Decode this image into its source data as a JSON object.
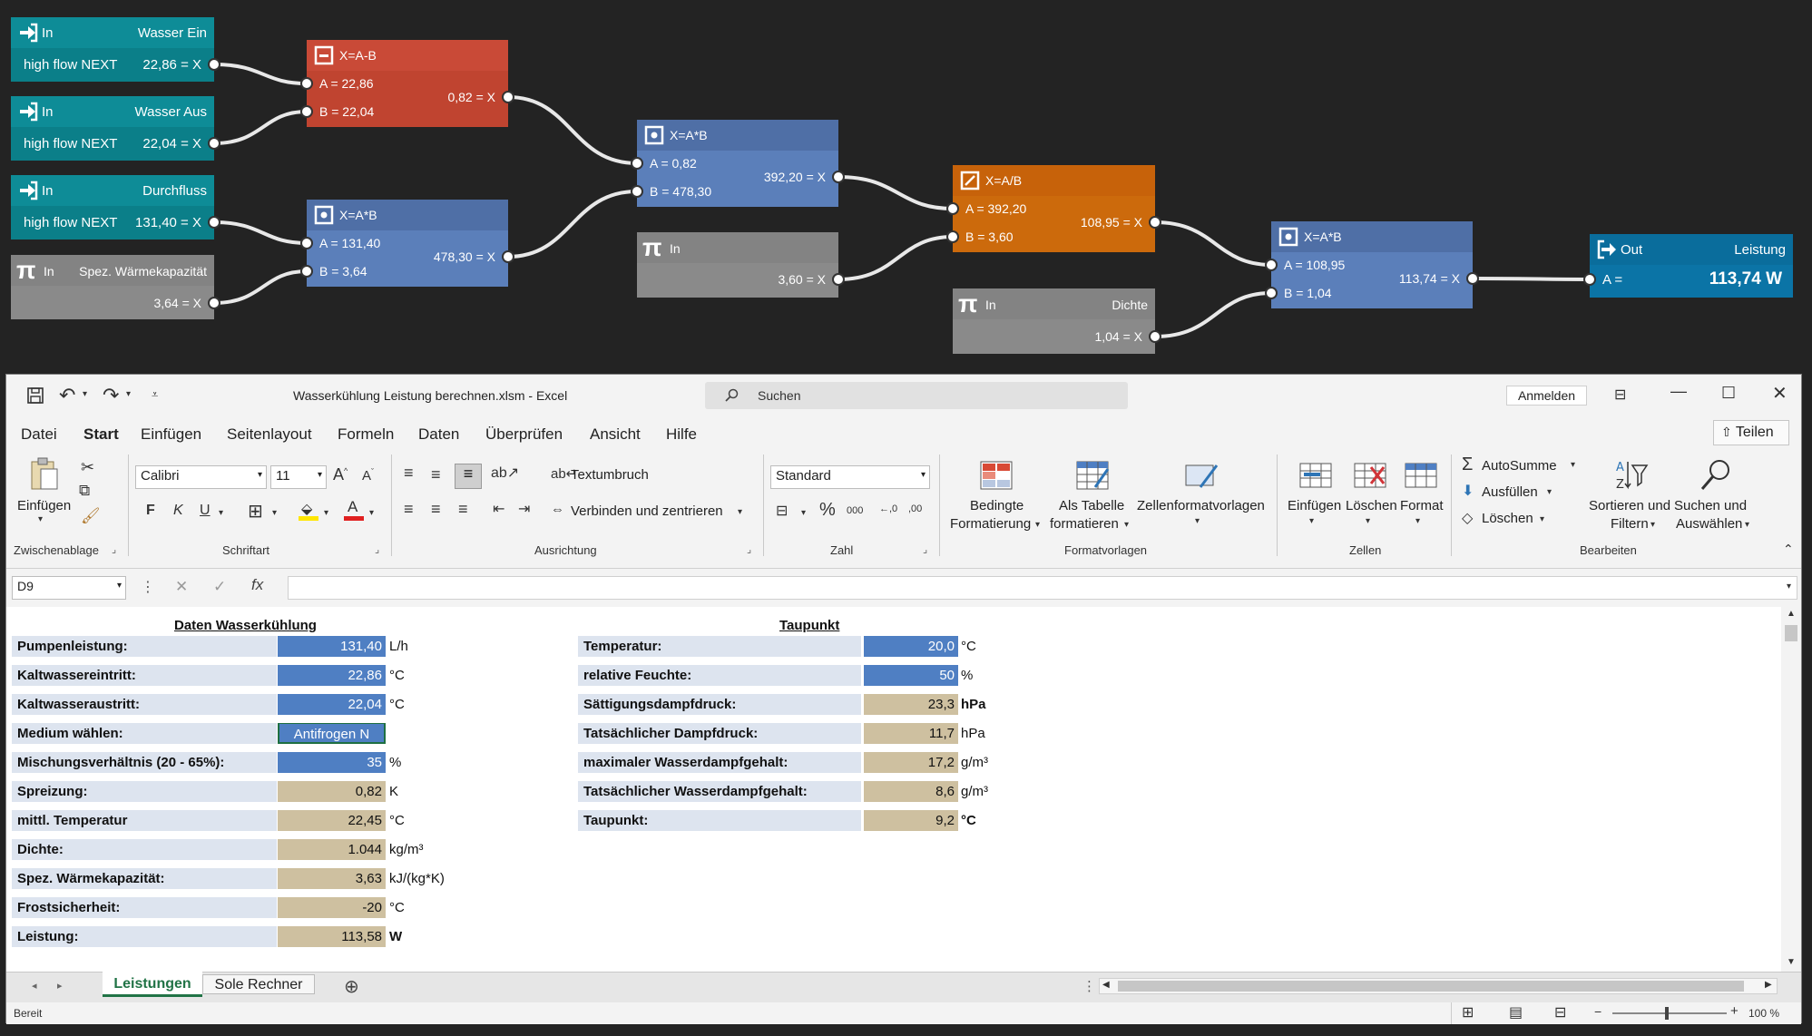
{
  "nodes": {
    "in1": {
      "kind": "In",
      "name": "Wasser Ein",
      "device": "high flow NEXT",
      "value": "22,86 = X"
    },
    "in2": {
      "kind": "In",
      "name": "Wasser Aus",
      "device": "high flow NEXT",
      "value": "22,04 = X"
    },
    "in3": {
      "kind": "In",
      "name": "Durchfluss",
      "device": "high flow NEXT",
      "value": "131,40 = X"
    },
    "const1": {
      "kind": "In",
      "name": "Spez. Wärmekapazität",
      "value": "3,64 = X"
    },
    "sub": {
      "op": "X=A-B",
      "a": "A = 22,86",
      "b": "B = 22,04",
      "out": "0,82 = X"
    },
    "mul1": {
      "op": "X=A*B",
      "a": "A = 131,40",
      "b": "B = 3,64",
      "out": "478,30 = X"
    },
    "mul2": {
      "op": "X=A*B",
      "a": "A = 0,82",
      "b": "B = 478,30",
      "out": "392,20 = X"
    },
    "const2": {
      "kind": "In",
      "value": "3,60 = X"
    },
    "div": {
      "op": "X=A/B",
      "a": "A = 392,20",
      "b": "B = 3,60",
      "out": "108,95 = X"
    },
    "const3": {
      "kind": "In",
      "name": "Dichte",
      "value": "1,04 = X"
    },
    "mul3": {
      "op": "X=A*B",
      "a": "A = 108,95",
      "b": "B = 1,04",
      "out": "113,74 = X"
    },
    "out": {
      "kind": "Out",
      "name": "Leistung",
      "a": "A =",
      "value": "113,74 W"
    }
  },
  "excel": {
    "title": "Wasserkühlung Leistung berechnen.xlsm  -  Excel",
    "search": "Suchen",
    "signin": "Anmelden",
    "share": "Teilen",
    "tabs": [
      "Datei",
      "Start",
      "Einfügen",
      "Seitenlayout",
      "Formeln",
      "Daten",
      "Überprüfen",
      "Ansicht",
      "Hilfe"
    ],
    "ribbon": {
      "paste": "Einfügen",
      "font": "Calibri",
      "size": "11",
      "wrap": "Textumbruch",
      "merge": "Verbinden und zentrieren",
      "numfmt": "Standard",
      "cond1": "Bedingte",
      "cond2": "Formatierung",
      "table1": "Als Tabelle",
      "table2": "formatieren",
      "cellstyles": "Zellenformatvorlagen",
      "ins": "Einfügen",
      "del": "Löschen",
      "fmt": "Format",
      "autosum": "AutoSumme",
      "fill": "Ausfüllen",
      "clear": "Löschen",
      "sort1": "Sortieren und",
      "sort2": "Filtern",
      "find1": "Suchen und",
      "find2": "Auswählen",
      "groups": {
        "clipboard": "Zwischenablage",
        "font": "Schriftart",
        "align": "Ausrichtung",
        "number": "Zahl",
        "styles": "Formatvorlagen",
        "cells": "Zellen",
        "edit": "Bearbeiten"
      }
    },
    "namebox": "D9",
    "sheet_tabs": [
      "Leistungen",
      "Sole Rechner"
    ],
    "status": "Bereit",
    "zoom": "100 %"
  },
  "left_table": {
    "header": "Daten Wasserkühlung",
    "rows": [
      {
        "label": "Pumpenleistung:",
        "value": "131,40",
        "unit": "L/h",
        "kind": "in"
      },
      {
        "label": "Kaltwassereintritt:",
        "value": "22,86",
        "unit": "°C",
        "kind": "in"
      },
      {
        "label": "Kaltwasseraustritt:",
        "value": "22,04",
        "unit": "°C",
        "kind": "in"
      },
      {
        "label": "Medium wählen:",
        "value": "Antifrogen N",
        "unit": "",
        "kind": "sel"
      },
      {
        "label": "Mischungsverhältnis (20 - 65%):",
        "value": "35",
        "unit": "%",
        "kind": "in"
      },
      {
        "label": "Spreizung:",
        "value": "0,82",
        "unit": "K",
        "kind": "out"
      },
      {
        "label": "mittl. Temperatur",
        "value": "22,45",
        "unit": "°C",
        "kind": "out"
      },
      {
        "label": "Dichte:",
        "value": "1.044",
        "unit": "kg/m³",
        "kind": "out"
      },
      {
        "label": "Spez. Wärmekapazität:",
        "value": "3,63",
        "unit": "kJ/(kg*K)",
        "kind": "out"
      },
      {
        "label": "Frostsicherheit:",
        "value": "-20",
        "unit": "°C",
        "kind": "out"
      },
      {
        "label": "Leistung:",
        "value": "113,58",
        "unit": "W",
        "kind": "outb"
      }
    ]
  },
  "right_table": {
    "header": "Taupunkt",
    "rows": [
      {
        "label": "Temperatur:",
        "value": "20,0",
        "unit": "°C",
        "kind": "in"
      },
      {
        "label": "relative Feuchte:",
        "value": "50",
        "unit": "%",
        "kind": "in"
      },
      {
        "label": "Sättigungsdampfdruck:",
        "value": "23,3",
        "unit": "hPa",
        "kind": "outb"
      },
      {
        "label": "Tatsächlicher Dampfdruck:",
        "value": "11,7",
        "unit": "hPa",
        "kind": "out"
      },
      {
        "label": "maximaler Wasserdampfgehalt:",
        "value": "17,2",
        "unit": "g/m³",
        "kind": "out"
      },
      {
        "label": "Tatsächlicher Wasserdampfgehalt:",
        "value": "8,6",
        "unit": "g/m³",
        "kind": "out"
      },
      {
        "label": "Taupunkt:",
        "value": "9,2",
        "unit": "°C",
        "kind": "outb"
      }
    ]
  }
}
